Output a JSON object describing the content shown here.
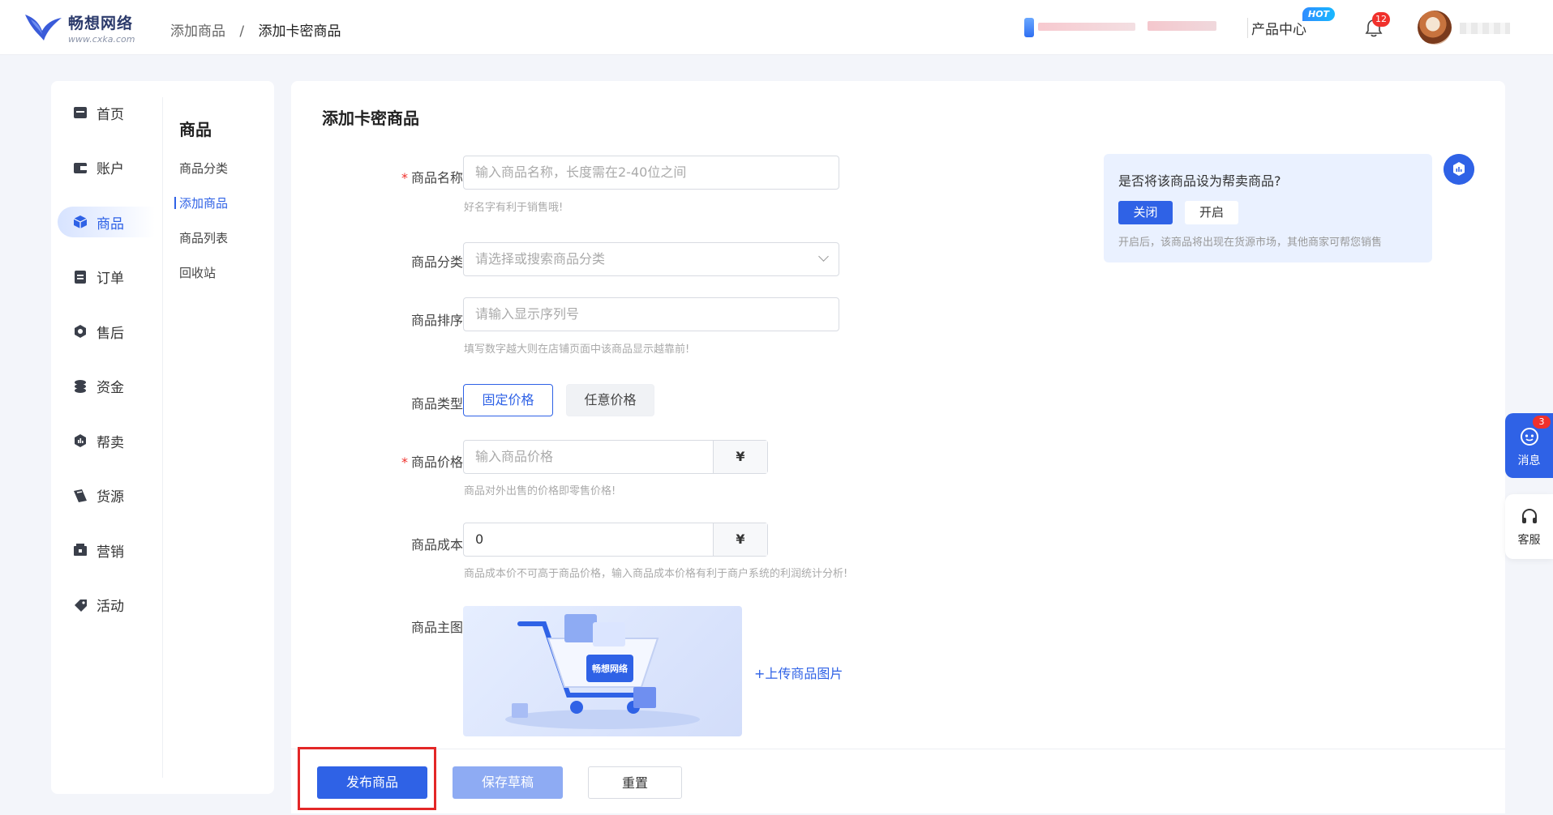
{
  "header": {
    "logo_name": "畅想网络",
    "logo_url": "www.cxka.com",
    "breadcrumb": [
      "添加商品",
      "添加卡密商品"
    ],
    "breadcrumb_sep": "/",
    "product_center": "产品中心",
    "hot_badge": "HOT",
    "notification_count": "12"
  },
  "sidebar": {
    "primary": [
      {
        "label": "首页",
        "icon": "home-icon"
      },
      {
        "label": "账户",
        "icon": "wallet-icon"
      },
      {
        "label": "商品",
        "icon": "box-icon",
        "active": true
      },
      {
        "label": "订单",
        "icon": "order-icon"
      },
      {
        "label": "售后",
        "icon": "aftersale-icon"
      },
      {
        "label": "资金",
        "icon": "coins-icon"
      },
      {
        "label": "帮卖",
        "icon": "help-sell-icon"
      },
      {
        "label": "货源",
        "icon": "supply-icon"
      },
      {
        "label": "营销",
        "icon": "marketing-icon"
      },
      {
        "label": "活动",
        "icon": "activity-icon"
      }
    ],
    "secondary_title": "商品",
    "secondary": [
      {
        "label": "商品分类"
      },
      {
        "label": "添加商品",
        "active": true
      },
      {
        "label": "商品列表"
      },
      {
        "label": "回收站"
      }
    ]
  },
  "form": {
    "title": "添加卡密商品",
    "name_label": "商品名称",
    "name_placeholder": "输入商品名称，长度需在2-40位之间",
    "name_hint": "好名字有利于销售哦!",
    "category_label": "商品分类",
    "category_placeholder": "请选择或搜索商品分类",
    "sort_label": "商品排序",
    "sort_placeholder": "请输入显示序列号",
    "sort_hint": "填写数字越大则在店铺页面中该商品显示越靠前!",
    "type_label": "商品类型",
    "type_options": [
      "固定价格",
      "任意价格"
    ],
    "price_label": "商品价格",
    "price_placeholder": "输入商品价格",
    "price_suffix": "¥",
    "price_hint": "商品对外出售的价格即零售价格!",
    "cost_label": "商品成本",
    "cost_value": "0",
    "cost_suffix": "¥",
    "cost_hint": "商品成本价不可高于商品价格，输入商品成本价格有利于商户系统的利润统计分析!",
    "image_label": "商品主图",
    "image_cart_label": "畅想网络",
    "upload_link": "+上传商品图片"
  },
  "promo": {
    "question": "是否将该商品设为帮卖商品?",
    "off_label": "关闭",
    "on_label": "开启",
    "note": "开启后，该商品将出现在货源市场，其他商家可帮您销售"
  },
  "actions": {
    "publish": "发布商品",
    "save_draft": "保存草稿",
    "reset": "重置"
  },
  "floating": {
    "message_label": "消息",
    "message_count": "3",
    "service_label": "客服"
  },
  "colors": {
    "primary": "#2f62e6",
    "danger": "#f0312c",
    "highlight_border": "#e32727"
  }
}
